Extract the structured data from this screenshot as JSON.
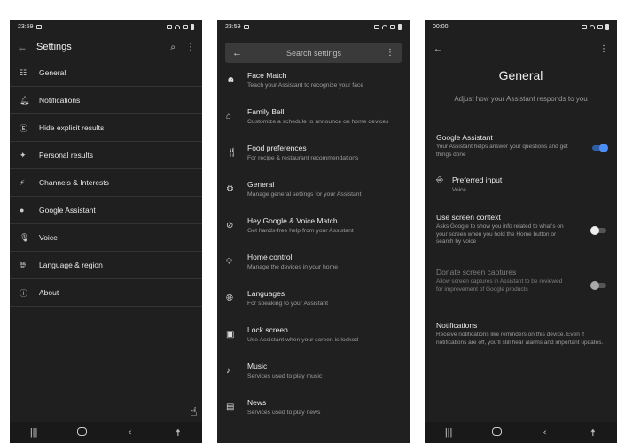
{
  "panel1": {
    "status": {
      "time": "23:59"
    },
    "title": "Settings",
    "items": [
      {
        "label": "General",
        "icon": "sliders-icon",
        "glyph": "☷"
      },
      {
        "label": "Notifications",
        "icon": "bell-icon",
        "glyph": "🔔︎"
      },
      {
        "label": "Hide explicit results",
        "icon": "explicit-icon",
        "glyph": "Ⓔ"
      },
      {
        "label": "Personal results",
        "icon": "sparkle-icon",
        "glyph": "✦"
      },
      {
        "label": "Channels & Interests",
        "icon": "wand-icon",
        "glyph": "⚡︎"
      },
      {
        "label": "Google Assistant",
        "icon": "assistant-icon",
        "glyph": "●"
      },
      {
        "label": "Voice",
        "icon": "mic-icon",
        "glyph": "🎙︎"
      },
      {
        "label": "Language & region",
        "icon": "globe-icon",
        "glyph": "🌐︎"
      },
      {
        "label": "About",
        "icon": "info-icon",
        "glyph": "ⓘ"
      }
    ]
  },
  "panel2": {
    "status": {
      "time": "23:59"
    },
    "search_placeholder": "Search settings",
    "items": [
      {
        "title": "Face Match",
        "subtitle": "Teach your Assistant to recognize your face",
        "icon": "face-icon",
        "glyph": "☻"
      },
      {
        "title": "Family Bell",
        "subtitle": "Customize a schedule to announce on home devices",
        "icon": "home-bell-icon",
        "glyph": "⌂"
      },
      {
        "title": "Food preferences",
        "subtitle": "For recipe & restaurant recommendations",
        "icon": "utensils-icon",
        "glyph": "🍴︎"
      },
      {
        "title": "General",
        "subtitle": "Manage general settings for your Assistant",
        "icon": "gear-icon",
        "glyph": "⚙"
      },
      {
        "title": "Hey Google & Voice Match",
        "subtitle": "Get hands-free help from your Assistant",
        "icon": "voice-match-icon",
        "glyph": "⊘"
      },
      {
        "title": "Home control",
        "subtitle": "Manage the devices in your home",
        "icon": "bulb-icon",
        "glyph": "💡︎"
      },
      {
        "title": "Languages",
        "subtitle": "For speaking to your Assistant",
        "icon": "globe-icon",
        "glyph": "🌐︎"
      },
      {
        "title": "Lock screen",
        "subtitle": "Use Assistant when your screen is locked",
        "icon": "lock-screen-icon",
        "glyph": "▣"
      },
      {
        "title": "Music",
        "subtitle": "Services used to play music",
        "icon": "music-icon",
        "glyph": "♪"
      },
      {
        "title": "News",
        "subtitle": "Services used to play news",
        "icon": "news-icon",
        "glyph": "▤"
      }
    ]
  },
  "panel3": {
    "status": {
      "time": "00:00"
    },
    "title": "General",
    "subtitle": "Adjust how your Assistant responds to you",
    "google_assistant": {
      "title": "Google Assistant",
      "desc": "Your Assistant helps answer your questions and get things done"
    },
    "preferred_input": {
      "title": "Preferred input",
      "value": "Voice"
    },
    "screen_context": {
      "title": "Use screen context",
      "desc": "Asks Google to show you info related to what's on your screen when you hold the Home button or search by voice"
    },
    "donate": {
      "title": "Donate screen captures",
      "desc": "Allow screen captures in Assistant to be reviewed for improvement of Google products"
    },
    "notifications": {
      "title": "Notifications",
      "desc": "Receive notifications like reminders on this device. Even if notifications are off, you'll still hear alarms and important updates."
    }
  },
  "colors": {
    "bg": "#1f1f1f",
    "accent": "#4c8df6"
  }
}
